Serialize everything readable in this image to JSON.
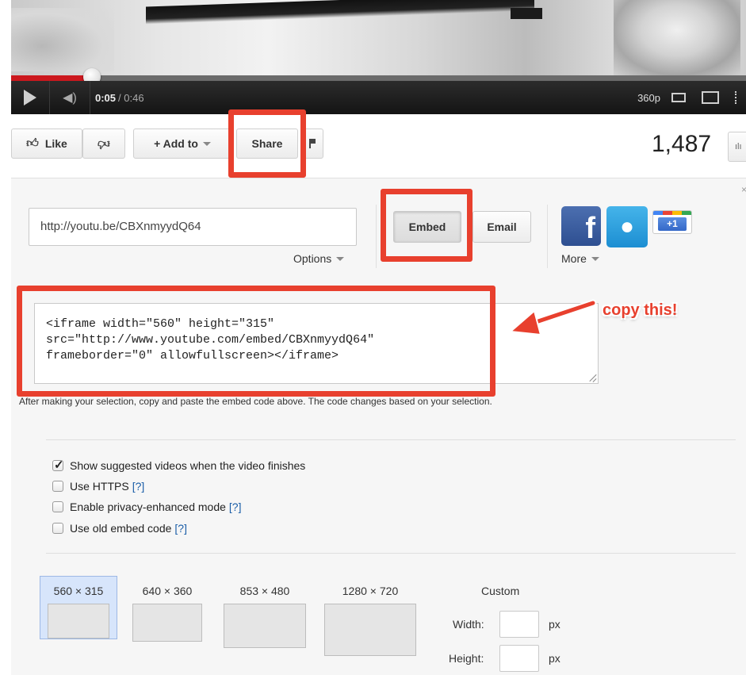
{
  "player": {
    "current_time": "0:05",
    "total_time": "/ 0:46",
    "progress_fraction": 0.11,
    "quality": "360p"
  },
  "actions": {
    "like_label": "Like",
    "add_to_label": "+ Add to",
    "share_label": "Share",
    "view_count": "1,487"
  },
  "share": {
    "short_url": "http://youtu.be/CBXnmyydQ64",
    "options_label": "Options",
    "embed_label": "Embed",
    "email_label": "Email",
    "more_label": "More",
    "gplus_label": "+1",
    "embed_code": "<iframe width=\"560\" height=\"315\"\nsrc=\"http://www.youtube.com/embed/CBXnmyydQ64\"\nframeborder=\"0\" allowfullscreen></iframe>",
    "annotation": "copy this!",
    "help_text": "After making your selection, copy and paste the embed code above. The code changes based on your selection."
  },
  "embed_options": [
    {
      "label": "Show suggested videos when the video finishes",
      "checked": true,
      "help": ""
    },
    {
      "label": "Use HTTPS",
      "checked": false,
      "help": "[?]"
    },
    {
      "label": "Enable privacy-enhanced mode",
      "checked": false,
      "help": "[?]"
    },
    {
      "label": "Use old embed code",
      "checked": false,
      "help": "[?]"
    }
  ],
  "sizes": [
    {
      "label": "560 × 315",
      "selected": true
    },
    {
      "label": "640 × 360",
      "selected": false
    },
    {
      "label": "853 × 480",
      "selected": false
    },
    {
      "label": "1280 × 720",
      "selected": false
    }
  ],
  "custom": {
    "label": "Custom",
    "width_label": "Width:",
    "height_label": "Height:",
    "unit": "px"
  },
  "colors": {
    "annotation_red": "#e8402e",
    "progress_red": "#cc181e",
    "link_blue": "#1b5ea8"
  }
}
